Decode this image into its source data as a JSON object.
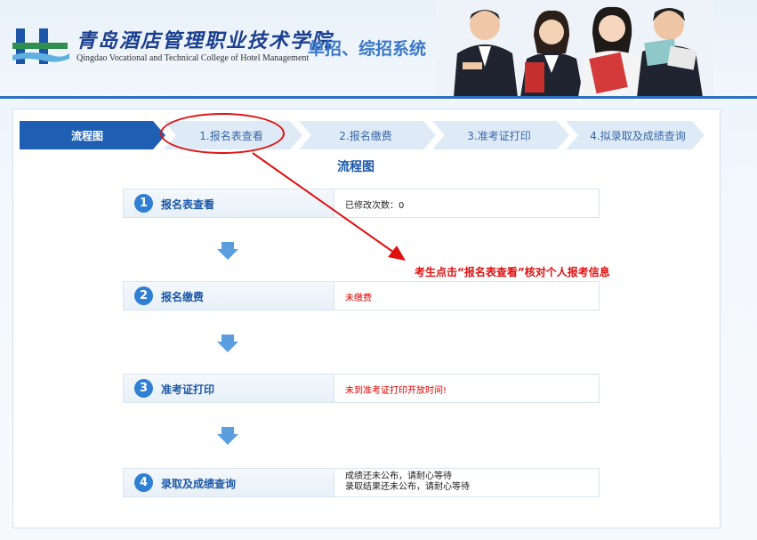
{
  "header": {
    "college_name_cn": "青岛酒店管理职业技术学院",
    "college_name_en": "Qingdao Vocational and Technical College of Hotel Management",
    "system_title": "单招、综招系统"
  },
  "tabs": [
    {
      "label": "流程图",
      "active": true
    },
    {
      "label": "1.报名表查看",
      "active": false
    },
    {
      "label": "2.报名缴费",
      "active": false
    },
    {
      "label": "3.准考证打印",
      "active": false
    },
    {
      "label": "4.拟录取及成绩查询",
      "active": false
    }
  ],
  "flow_title": "流程图",
  "steps": [
    {
      "num": "1",
      "label": "报名表查看",
      "status": "已修改次数：0",
      "status_color": "#222222"
    },
    {
      "num": "2",
      "label": "报名缴费",
      "status": "未缴费",
      "status_color": "#e00000"
    },
    {
      "num": "3",
      "label": "准考证打印",
      "status": "未到准考证打印开放时间!",
      "status_color": "#e00000"
    },
    {
      "num": "4",
      "label": "录取及成绩查询",
      "status_line1": "成绩还未公布，请耐心等待",
      "status_line2": "录取结果还未公布，请耐心等待",
      "status_color": "#222222"
    }
  ],
  "annotation": {
    "text": "考生点击“报名表查看”核对个人报考信息",
    "color": "#e01010"
  },
  "colors": {
    "accent": "#2a6fc2",
    "active_tab": "#1e5fb4",
    "tab_bg": "#deebf7"
  }
}
